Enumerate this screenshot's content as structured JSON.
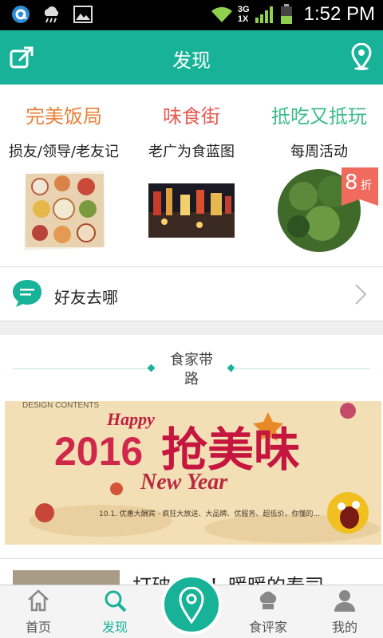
{
  "status_bar": {
    "time": "1:52 PM",
    "network": [
      "3G",
      "1X"
    ]
  },
  "header": {
    "title": "发现"
  },
  "categories": [
    {
      "title": "完美饭局",
      "subtitle": "损友/领导/老友记",
      "color": "#e8823a"
    },
    {
      "title": "味食街",
      "subtitle": "老广为食蓝图",
      "color": "#e85a50"
    },
    {
      "title": "抵吃又抵玩",
      "subtitle": "每周活动",
      "color": "#3dbb8a",
      "badge": "8",
      "badge_unit": "折"
    }
  ],
  "friend_section": {
    "label": "好友去哪"
  },
  "guide_section": {
    "title": "食家带路"
  },
  "banner": {
    "header_text": "DESIGN CONTENTS",
    "happy": "Happy",
    "year": "2016",
    "main": "抢美味",
    "new_year": "New Year",
    "tagline": "10.1. 优惠大酬宾 · 疯狂大放送、大品牌、优服务、超低价，你懂的..."
  },
  "article": {
    "title": "打破……！暖暖的寿司"
  },
  "tabbar": [
    {
      "label": "首页",
      "icon": "home-icon",
      "active": false
    },
    {
      "label": "发现",
      "icon": "search-icon",
      "active": true
    },
    {
      "label": "",
      "icon": "location-pin-icon",
      "active": false
    },
    {
      "label": "食评家",
      "icon": "chef-hat-icon",
      "active": false
    },
    {
      "label": "我的",
      "icon": "person-icon",
      "active": false
    }
  ],
  "colors": {
    "accent": "#17b298",
    "badge": "#ef6b5e"
  }
}
